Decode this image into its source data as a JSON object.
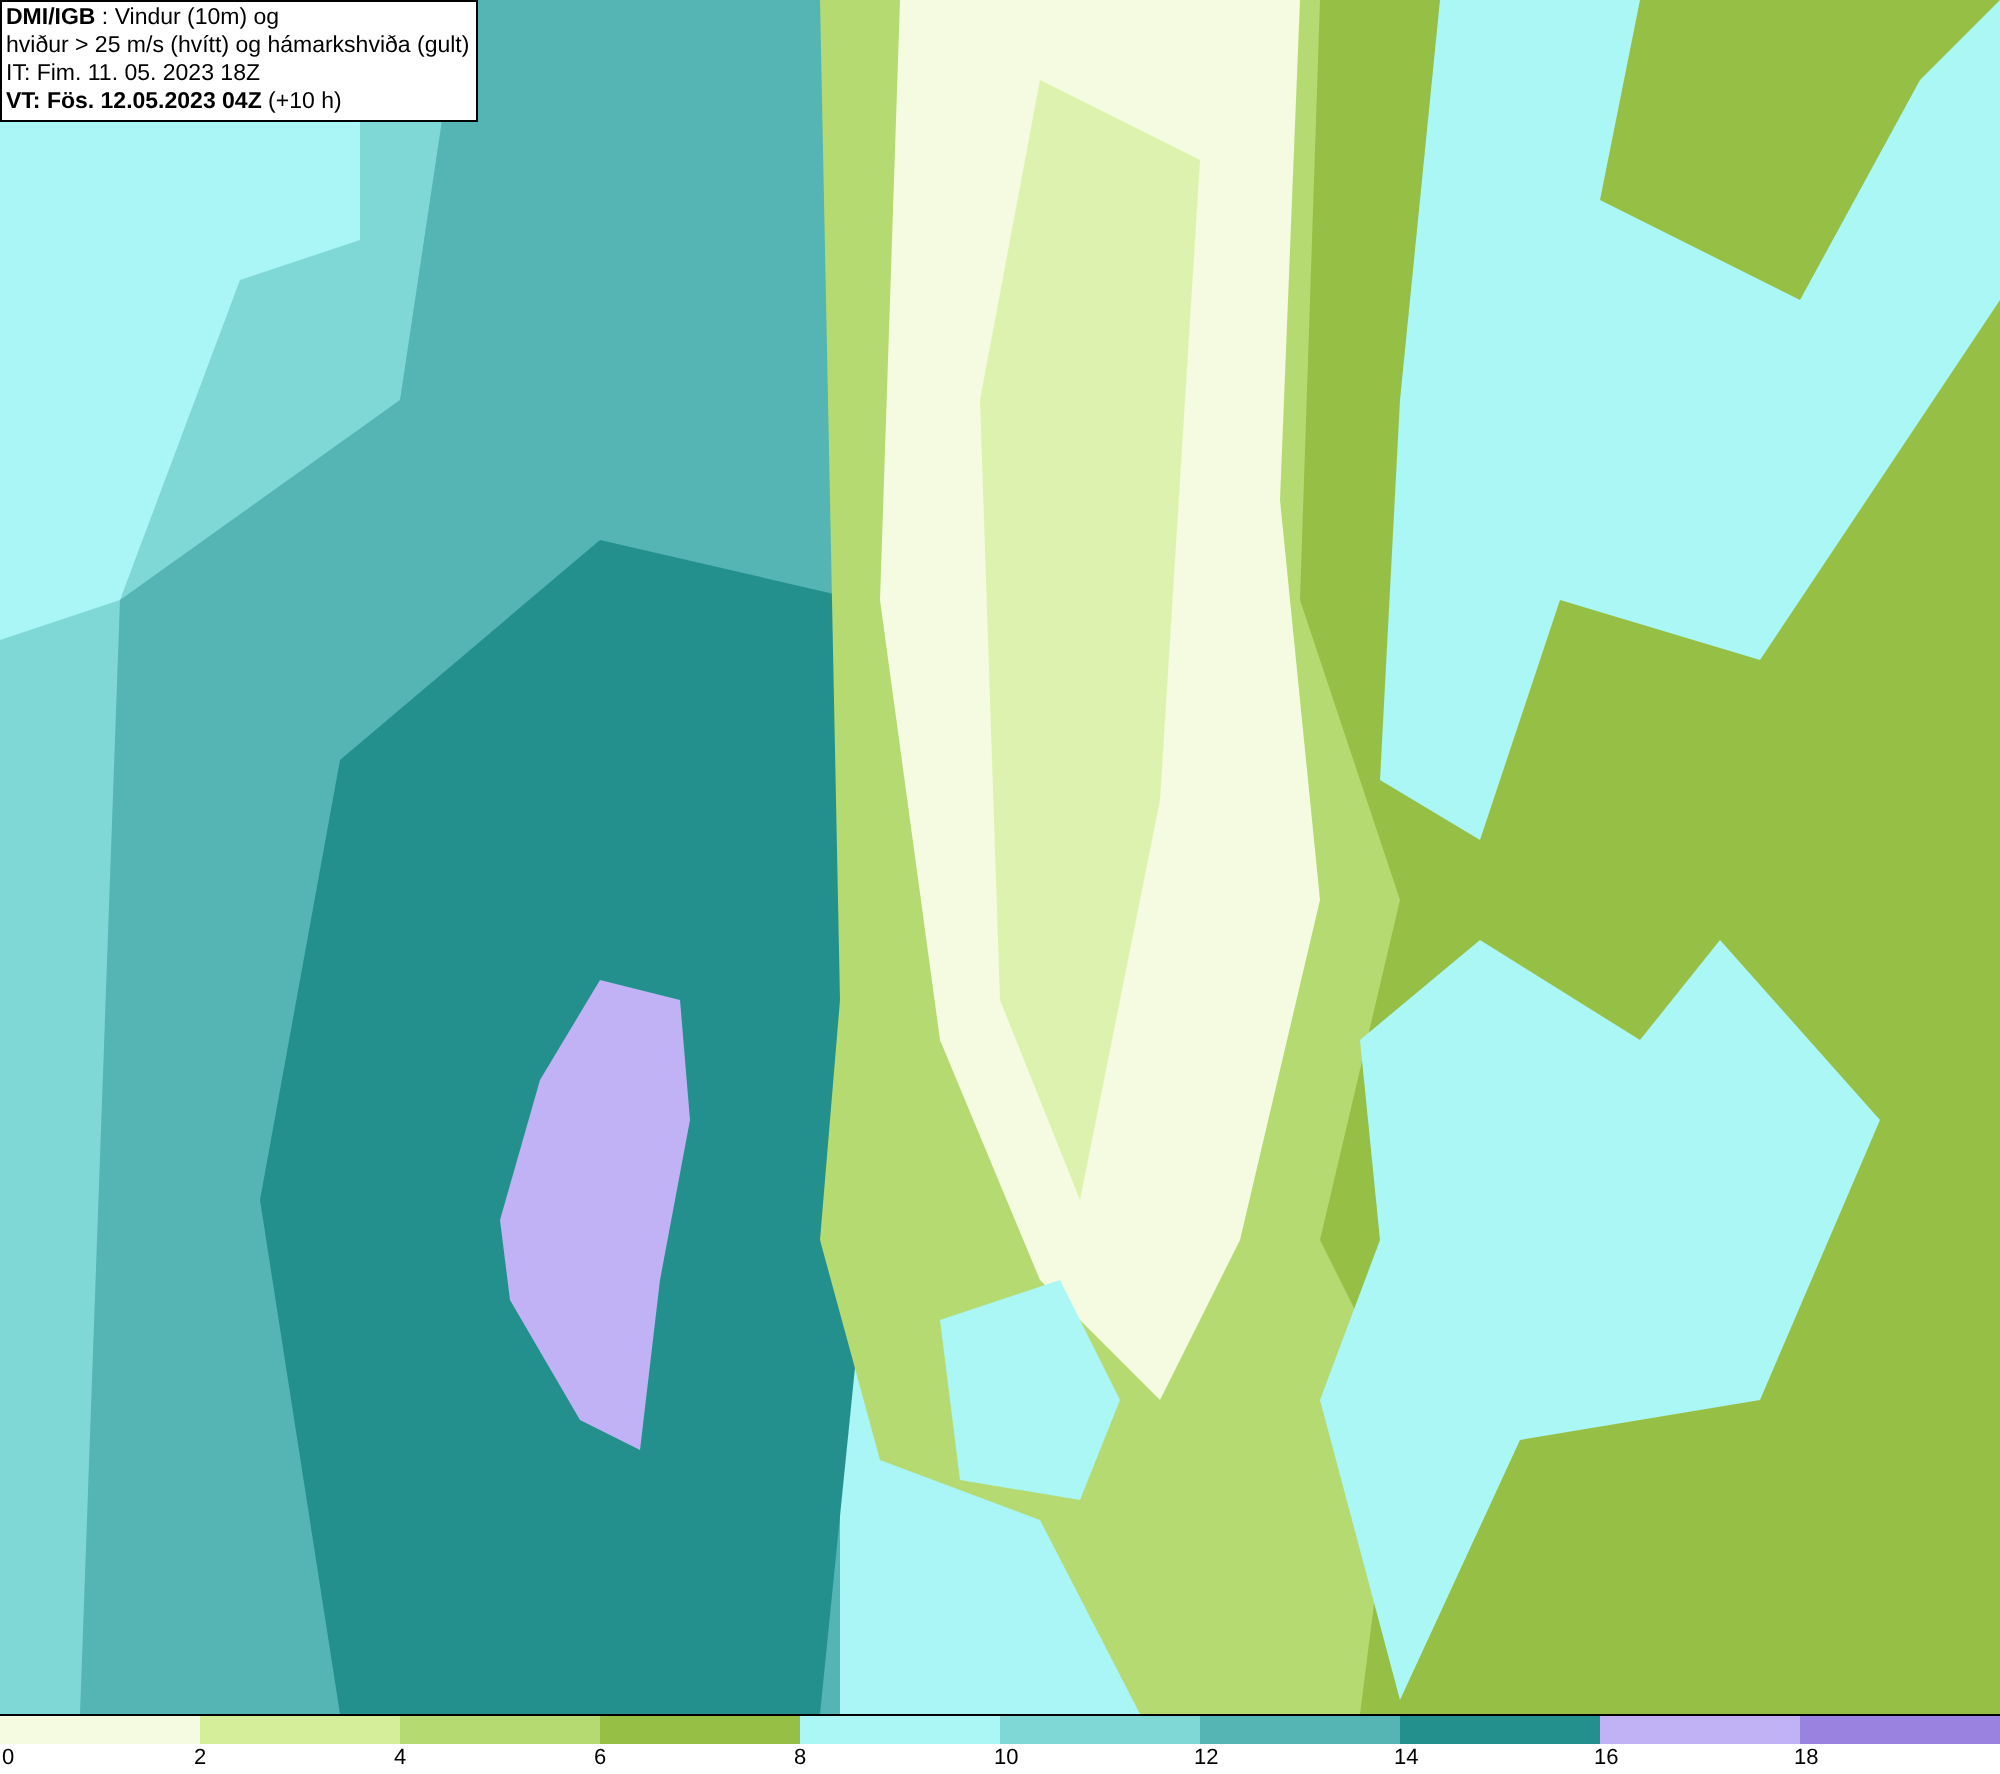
{
  "header": {
    "lines": [
      "**DMI/IGB** : Vindur (10m) og",
      "hviður > 25 m/s (hvítt) og hámarkshviða (gult)",
      "IT: Fim. 11. 05. 2023 18Z",
      "**VT: Fös. 12.05.2023 04Z** (+10 h)"
    ]
  },
  "legend": {
    "bins": [
      {
        "color": "#f5fbe0"
      },
      {
        "color": "#d4ee9a"
      },
      {
        "color": "#b5da72"
      },
      {
        "color": "#96bf45"
      },
      {
        "color": "#aaf7f5"
      },
      {
        "color": "#80d8d6"
      },
      {
        "color": "#55b4b4"
      },
      {
        "color": "#24908e"
      },
      {
        "color": "#c0b2f5"
      },
      {
        "color": "#9a82e0"
      }
    ],
    "ticks": [
      "0",
      "2",
      "4",
      "6",
      "8",
      "10",
      "12",
      "14",
      "16",
      "18"
    ]
  }
}
